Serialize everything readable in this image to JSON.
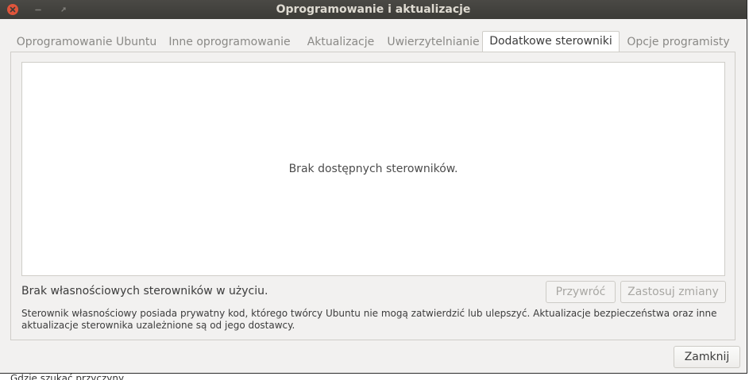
{
  "window": {
    "title": "Oprogramowanie i aktualizacje"
  },
  "tabs": [
    {
      "label": "Oprogramowanie Ubuntu",
      "active": false
    },
    {
      "label": "Inne oprogramowanie",
      "active": false
    },
    {
      "label": "Aktualizacje",
      "active": false
    },
    {
      "label": "Uwierzytelnianie",
      "active": false
    },
    {
      "label": "Dodatkowe sterowniki",
      "active": true
    },
    {
      "label": "Opcje programisty",
      "active": false
    }
  ],
  "drivers": {
    "empty_message": "Brak dostępnych sterowników.",
    "status": "Brak własnościowych sterowników w użyciu.",
    "revert_label": "Przywróć",
    "apply_label": "Zastosuj zmiany",
    "info": "Sterownik własnościowy posiada prywatny kod, którego twórcy Ubuntu nie mogą zatwierdzić lub ulepszyć. Aktualizacje bezpieczeństwa oraz inne aktualizacje sterownika uzależnione są od jego dostawcy."
  },
  "footer": {
    "close_label": "Zamknij"
  },
  "background": {
    "text": "Gdzie szukać przyczyny"
  },
  "colors": {
    "titlebar": "#3c3b37",
    "close_button": "#e0553b",
    "window_bg": "#f2f1f0"
  }
}
